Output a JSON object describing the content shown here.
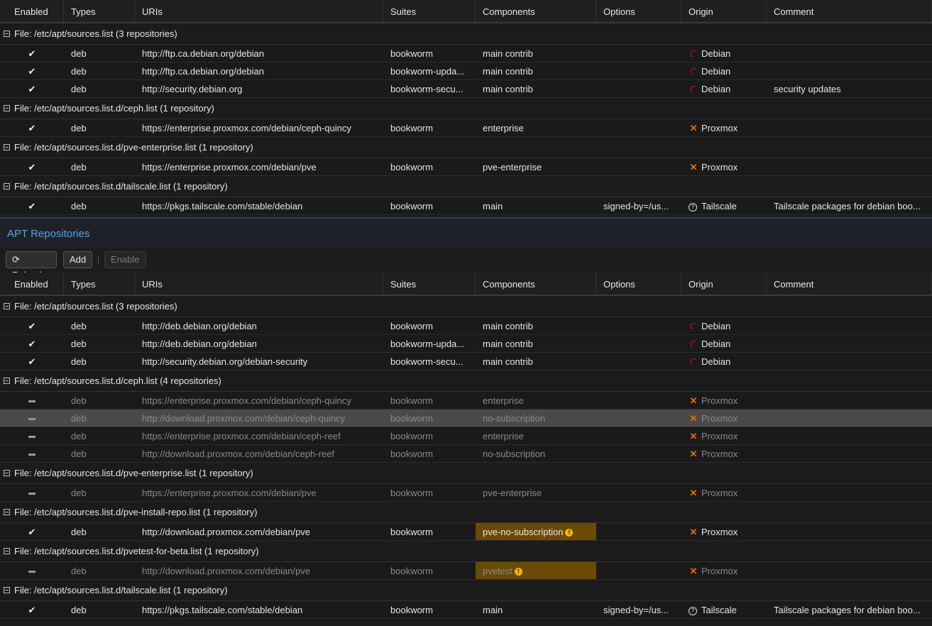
{
  "columns": [
    "Enabled",
    "Types",
    "URIs",
    "Suites",
    "Components",
    "Options",
    "Origin",
    "Comment"
  ],
  "top_grid": {
    "groups": [
      {
        "label": "File: /etc/apt/sources.list (3 repositories)",
        "rows": [
          {
            "enabled": true,
            "type": "deb",
            "uri": "http://ftp.ca.debian.org/debian",
            "suite": "bookworm",
            "components": "main contrib",
            "options": "",
            "origin": "Debian",
            "origin_icon": "debian",
            "comment": ""
          },
          {
            "enabled": true,
            "type": "deb",
            "uri": "http://ftp.ca.debian.org/debian",
            "suite": "bookworm-upda...",
            "components": "main contrib",
            "options": "",
            "origin": "Debian",
            "origin_icon": "debian",
            "comment": ""
          },
          {
            "enabled": true,
            "type": "deb",
            "uri": "http://security.debian.org",
            "suite": "bookworm-secu...",
            "components": "main contrib",
            "options": "",
            "origin": "Debian",
            "origin_icon": "debian",
            "comment": "security updates"
          }
        ]
      },
      {
        "label": "File: /etc/apt/sources.list.d/ceph.list (1 repository)",
        "rows": [
          {
            "enabled": true,
            "type": "deb",
            "uri": "https://enterprise.proxmox.com/debian/ceph-quincy",
            "suite": "bookworm",
            "components": "enterprise",
            "options": "",
            "origin": "Proxmox",
            "origin_icon": "proxmox",
            "comment": ""
          }
        ]
      },
      {
        "label": "File: /etc/apt/sources.list.d/pve-enterprise.list (1 repository)",
        "rows": [
          {
            "enabled": true,
            "type": "deb",
            "uri": "https://enterprise.proxmox.com/debian/pve",
            "suite": "bookworm",
            "components": "pve-enterprise",
            "options": "",
            "origin": "Proxmox",
            "origin_icon": "proxmox",
            "comment": ""
          }
        ]
      },
      {
        "label": "File: /etc/apt/sources.list.d/tailscale.list (1 repository)",
        "rows": [
          {
            "enabled": true,
            "type": "deb",
            "uri": "https://pkgs.tailscale.com/stable/debian",
            "suite": "bookworm",
            "components": "main",
            "options": "signed-by=/us...",
            "origin": "Tailscale",
            "origin_icon": "unknown",
            "comment": "Tailscale packages for debian boo..."
          }
        ]
      }
    ]
  },
  "panel": {
    "title": "APT Repositories"
  },
  "toolbar": {
    "reload": "Reload",
    "add": "Add",
    "enable": "Enable"
  },
  "bottom_grid": {
    "groups": [
      {
        "label": "File: /etc/apt/sources.list (3 repositories)",
        "rows": [
          {
            "enabled": true,
            "type": "deb",
            "uri": "http://deb.debian.org/debian",
            "suite": "bookworm",
            "components": "main contrib",
            "options": "",
            "origin": "Debian",
            "origin_icon": "debian",
            "comment": ""
          },
          {
            "enabled": true,
            "type": "deb",
            "uri": "http://deb.debian.org/debian",
            "suite": "bookworm-upda...",
            "components": "main contrib",
            "options": "",
            "origin": "Debian",
            "origin_icon": "debian",
            "comment": ""
          },
          {
            "enabled": true,
            "type": "deb",
            "uri": "http://security.debian.org/debian-security",
            "suite": "bookworm-secu...",
            "components": "main contrib",
            "options": "",
            "origin": "Debian",
            "origin_icon": "debian",
            "comment": ""
          }
        ]
      },
      {
        "label": "File: /etc/apt/sources.list.d/ceph.list (4 repositories)",
        "rows": [
          {
            "enabled": false,
            "type": "deb",
            "uri": "https://enterprise.proxmox.com/debian/ceph-quincy",
            "suite": "bookworm",
            "components": "enterprise",
            "options": "",
            "origin": "Proxmox",
            "origin_icon": "proxmox",
            "comment": ""
          },
          {
            "enabled": false,
            "selected": true,
            "type": "deb",
            "uri": "http://download.proxmox.com/debian/ceph-quincy",
            "suite": "bookworm",
            "components": "no-subscription",
            "options": "",
            "origin": "Proxmox",
            "origin_icon": "proxmox",
            "comment": ""
          },
          {
            "enabled": false,
            "type": "deb",
            "uri": "https://enterprise.proxmox.com/debian/ceph-reef",
            "suite": "bookworm",
            "components": "enterprise",
            "options": "",
            "origin": "Proxmox",
            "origin_icon": "proxmox",
            "comment": ""
          },
          {
            "enabled": false,
            "type": "deb",
            "uri": "http://download.proxmox.com/debian/ceph-reef",
            "suite": "bookworm",
            "components": "no-subscription",
            "options": "",
            "origin": "Proxmox",
            "origin_icon": "proxmox",
            "comment": ""
          }
        ]
      },
      {
        "label": "File: /etc/apt/sources.list.d/pve-enterprise.list (1 repository)",
        "rows": [
          {
            "enabled": false,
            "type": "deb",
            "uri": "https://enterprise.proxmox.com/debian/pve",
            "suite": "bookworm",
            "components": "pve-enterprise",
            "options": "",
            "origin": "Proxmox",
            "origin_icon": "proxmox",
            "comment": ""
          }
        ]
      },
      {
        "label": "File: /etc/apt/sources.list.d/pve-install-repo.list (1 repository)",
        "rows": [
          {
            "enabled": true,
            "type": "deb",
            "uri": "http://download.proxmox.com/debian/pve",
            "suite": "bookworm",
            "components": "pve-no-subscription",
            "components_warning": true,
            "options": "",
            "origin": "Proxmox",
            "origin_icon": "proxmox",
            "comment": ""
          }
        ]
      },
      {
        "label": "File: /etc/apt/sources.list.d/pvetest-for-beta.list (1 repository)",
        "rows": [
          {
            "enabled": false,
            "type": "deb",
            "uri": "http://download.proxmox.com/debian/pve",
            "suite": "bookworm",
            "components": "pvetest",
            "components_warning": true,
            "options": "",
            "origin": "Proxmox",
            "origin_icon": "proxmox",
            "comment": ""
          }
        ]
      },
      {
        "label": "File: /etc/apt/sources.list.d/tailscale.list (1 repository)",
        "rows": [
          {
            "enabled": true,
            "type": "deb",
            "uri": "https://pkgs.tailscale.com/stable/debian",
            "suite": "bookworm",
            "components": "main",
            "options": "signed-by=/us...",
            "origin": "Tailscale",
            "origin_icon": "unknown",
            "comment": "Tailscale packages for debian boo..."
          }
        ]
      }
    ]
  }
}
